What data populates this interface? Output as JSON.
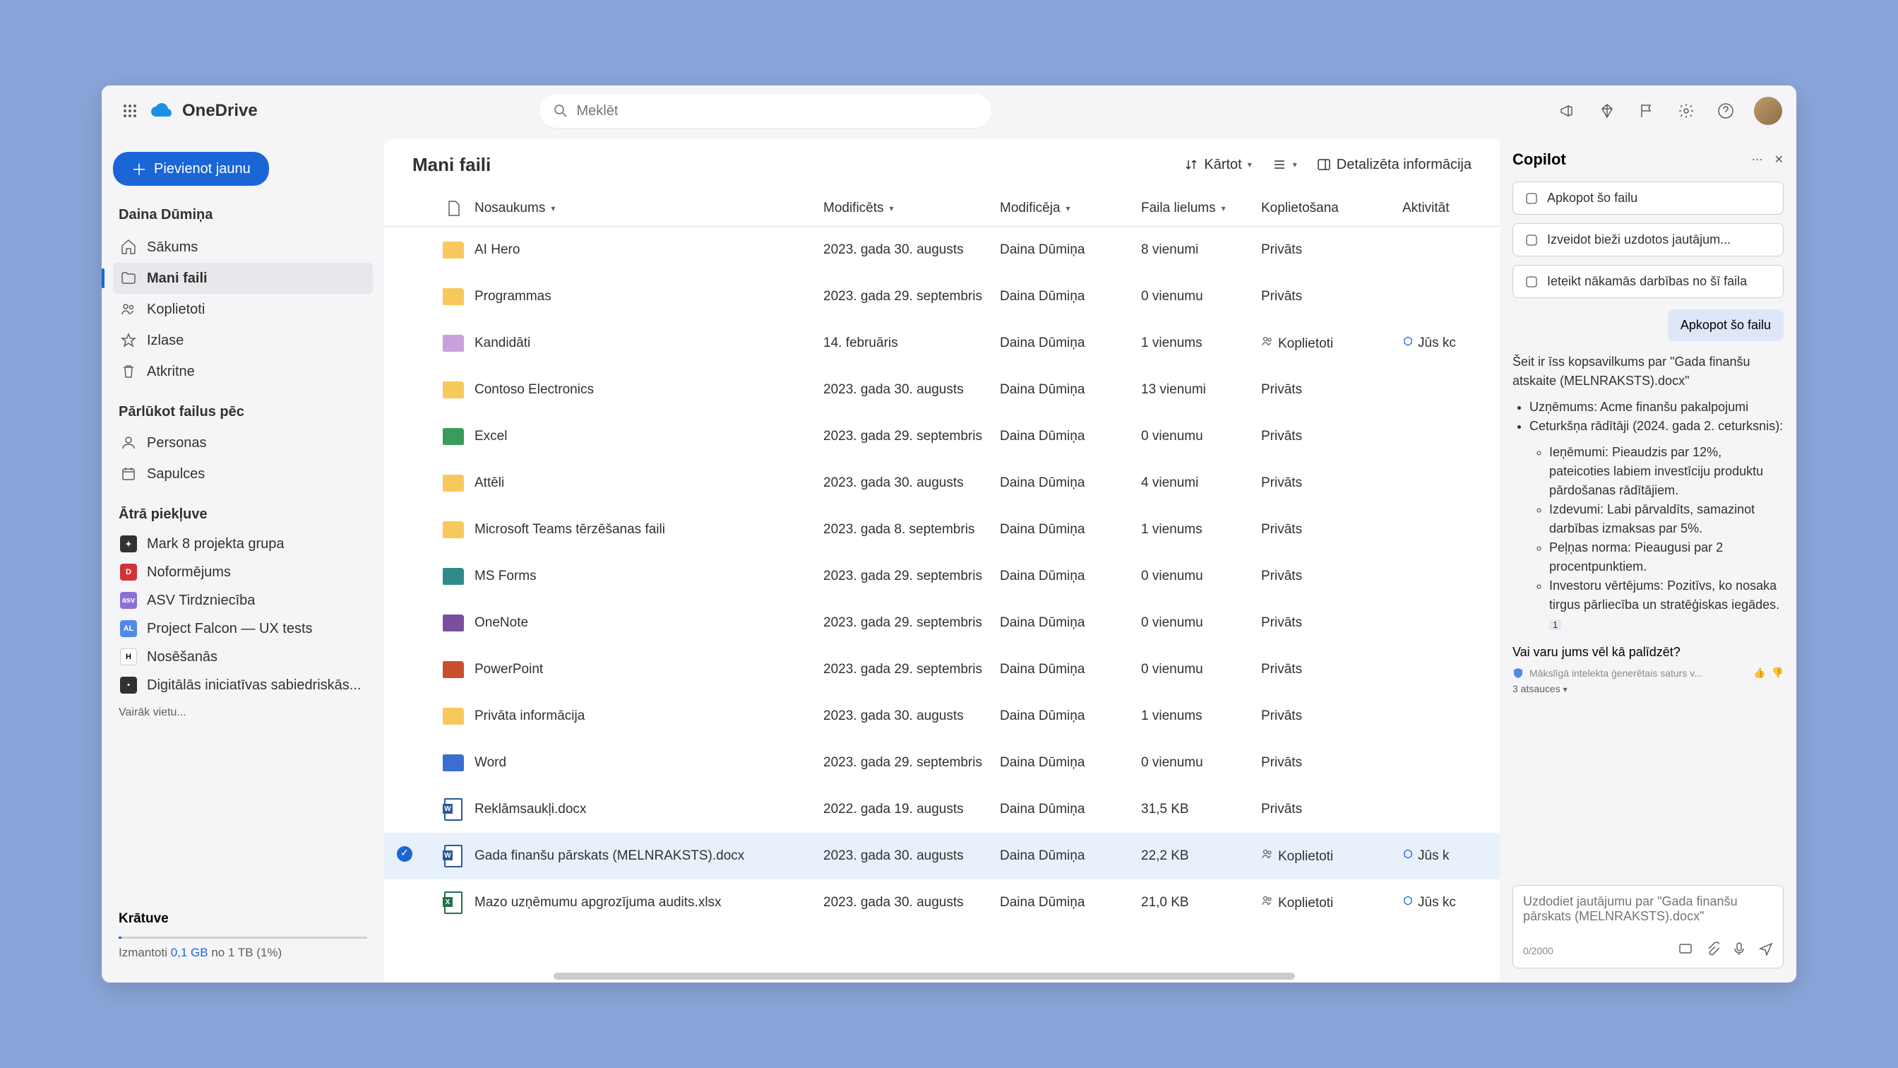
{
  "app": {
    "name": "OneDrive"
  },
  "search": {
    "placeholder": "Meklēt"
  },
  "sidebar": {
    "addNew": "Pievienot jaunu",
    "userName": "Daina Dūmiņa",
    "nav": [
      {
        "label": "Sākums",
        "icon": "home"
      },
      {
        "label": "Mani faili",
        "icon": "folder",
        "active": true
      },
      {
        "label": "Koplietoti",
        "icon": "people"
      },
      {
        "label": "Izlase",
        "icon": "star"
      },
      {
        "label": "Atkritne",
        "icon": "trash"
      }
    ],
    "browseHeader": "Pārlūkot failus pēc",
    "browse": [
      {
        "label": "Personas",
        "icon": "person"
      },
      {
        "label": "Sapulces",
        "icon": "calendar"
      }
    ],
    "quickHeader": "Ātrā piekļuve",
    "quick": [
      {
        "label": "Mark 8 projekta grupa",
        "color": "#323130",
        "initial": "✦"
      },
      {
        "label": "Noformējums",
        "color": "#d13438",
        "initial": "D"
      },
      {
        "label": "ASV Tirdzniecība",
        "color": "#8b6fd4",
        "initial": "asv"
      },
      {
        "label": "Project Falcon — UX tests",
        "color": "#4f8ae8",
        "initial": "AL"
      },
      {
        "label": "Nosēšanās",
        "color": "#fff",
        "initial": "H",
        "textColor": "#000"
      },
      {
        "label": "Digitālās iniciatīvas sabiedriskās...",
        "color": "#323130",
        "initial": "•"
      }
    ],
    "moreLocations": "Vairāk vietu...",
    "storage": {
      "title": "Krātuve",
      "prefix": "Izmantoti ",
      "used": "0,1 GB",
      "suffix": " no 1 TB (1%)"
    }
  },
  "main": {
    "title": "Mani faili",
    "sortLabel": "Kārtot",
    "detailsLabel": "Detalizēta informācija",
    "columns": {
      "name": "Nosaukums",
      "modified": "Modificēts",
      "modifiedBy": "Modificēja",
      "size": "Faila lielums",
      "sharing": "Koplietošana",
      "activity": "Aktivitāt"
    },
    "rows": [
      {
        "type": "folder",
        "color": "#f7c95c",
        "name": "AI Hero",
        "modified": "2023. gada 30. augusts",
        "modifiedBy": "Daina Dūmiņa",
        "size": "8 vienumi",
        "sharing": "Privāts"
      },
      {
        "type": "folder",
        "color": "#f7c95c",
        "name": "Programmas",
        "modified": "2023. gada 29. septembris",
        "modifiedBy": "Daina Dūmiņa",
        "size": "0 vienumu",
        "sharing": "Privāts"
      },
      {
        "type": "folder",
        "color": "#c9a0dc",
        "name": "Kandidāti",
        "modified": "14. februāris",
        "modifiedBy": "Daina Dūmiņa",
        "size": "1 vienums",
        "sharing": "Koplietoti",
        "shared": true,
        "activity": "Jūs kc"
      },
      {
        "type": "folder",
        "color": "#f7c95c",
        "name": "Contoso Electronics",
        "modified": "2023. gada 30. augusts",
        "modifiedBy": "Daina Dūmiņa",
        "size": "13 vienumi",
        "sharing": "Privāts"
      },
      {
        "type": "folder",
        "color": "#3a9b5c",
        "name": "Excel",
        "modified": "2023. gada 29. septembris",
        "modifiedBy": "Daina Dūmiņa",
        "size": "0 vienumu",
        "sharing": "Privāts"
      },
      {
        "type": "folder",
        "color": "#f7c95c",
        "name": "Attēli",
        "modified": "2023. gada 30. augusts",
        "modifiedBy": "Daina Dūmiņa",
        "size": "4 vienumi",
        "sharing": "Privāts"
      },
      {
        "type": "folder",
        "color": "#f7c95c",
        "name": "Microsoft Teams tērzēšanas faili",
        "modified": "2023. gada 8. septembris",
        "modifiedBy": "Daina Dūmiņa",
        "size": "1 vienums",
        "sharing": "Privāts"
      },
      {
        "type": "folder",
        "color": "#2f8a8a",
        "name": "MS Forms",
        "modified": "2023. gada 29. septembris",
        "modifiedBy": "Daina Dūmiņa",
        "size": "0 vienumu",
        "sharing": "Privāts"
      },
      {
        "type": "folder",
        "color": "#7b4fa0",
        "name": "OneNote",
        "modified": "2023. gada 29. septembris",
        "modifiedBy": "Daina Dūmiņa",
        "size": "0 vienumu",
        "sharing": "Privāts"
      },
      {
        "type": "folder",
        "color": "#c94f2f",
        "name": "PowerPoint",
        "modified": "2023. gada 29. septembris",
        "modifiedBy": "Daina Dūmiņa",
        "size": "0 vienumu",
        "sharing": "Privāts"
      },
      {
        "type": "folder",
        "color": "#f7c95c",
        "name": "Privāta informācija",
        "modified": "2023. gada 30. augusts",
        "modifiedBy": "Daina Dūmiņa",
        "size": "1 vienums",
        "sharing": "Privāts"
      },
      {
        "type": "folder",
        "color": "#3a6fd0",
        "name": "Word",
        "modified": "2023. gada 29. septembris",
        "modifiedBy": "Daina Dūmiņa",
        "size": "0 vienumu",
        "sharing": "Privāts"
      },
      {
        "type": "word",
        "name": "Reklāmsaukļi.docx",
        "modified": "2022. gada 19. augusts",
        "modifiedBy": "Daina Dūmiņa",
        "size": "31,5 KB",
        "sharing": "Privāts"
      },
      {
        "type": "word",
        "name": "Gada finanšu pārskats (MELNRAKSTS).docx",
        "modified": "2023. gada 30. augusts",
        "modifiedBy": "Daina Dūmiņa",
        "size": "22,2 KB",
        "sharing": "Koplietoti",
        "shared": true,
        "activity": "Jūs k",
        "selected": true
      },
      {
        "type": "excel",
        "name": "Mazo uzņēmumu apgrozījuma audits.xlsx",
        "modified": "2023. gada 30. augusts",
        "modifiedBy": "Daina Dūmiņa",
        "size": "21,0 KB",
        "sharing": "Koplietoti",
        "shared": true,
        "activity": "Jūs kc"
      }
    ]
  },
  "copilot": {
    "title": "Copilot",
    "suggestions": [
      "Apkopot šo failu",
      "Izveidot bieži uzdotos jautājum...",
      "Ieteikt nākamās darbības no šī faila"
    ],
    "userMessage": "Apkopot šo failu",
    "response": {
      "intro": "Šeit ir īss kopsavilkums par \"Gada finanšu atskaite (MELNRAKSTS).docx\"",
      "b1": "Uzņēmums: Acme finanšu pakalpojumi",
      "b2": "Ceturkšņa rādītāji (2024. gada 2. ceturksnis):",
      "s1": "Ieņēmumi: Pieaudzis par 12%, pateicoties labiem investīciju produktu pārdošanas rādītājiem.",
      "s2": "Izdevumi: Labi pārvaldīts, samazinot darbības izmaksas par 5%.",
      "s3": "Peļņas norma: Pieaugusi par 2 procentpunktiem.",
      "s4": "Investoru vērtējums: Pozitīvs, ko nosaka tirgus pārliecība un stratēģiskas iegādes.",
      "ref1": "1"
    },
    "followup": "Vai varu jums vēl kā palīdzēt?",
    "disclaimer": "Mākslīgā intelekta ģenerētais saturs v...",
    "references": "3 atsauces",
    "inputPlaceholder": "Uzdodiet jautājumu par \"Gada finanšu pārskats (MELNRAKSTS).docx\"",
    "charCount": "0/2000"
  }
}
